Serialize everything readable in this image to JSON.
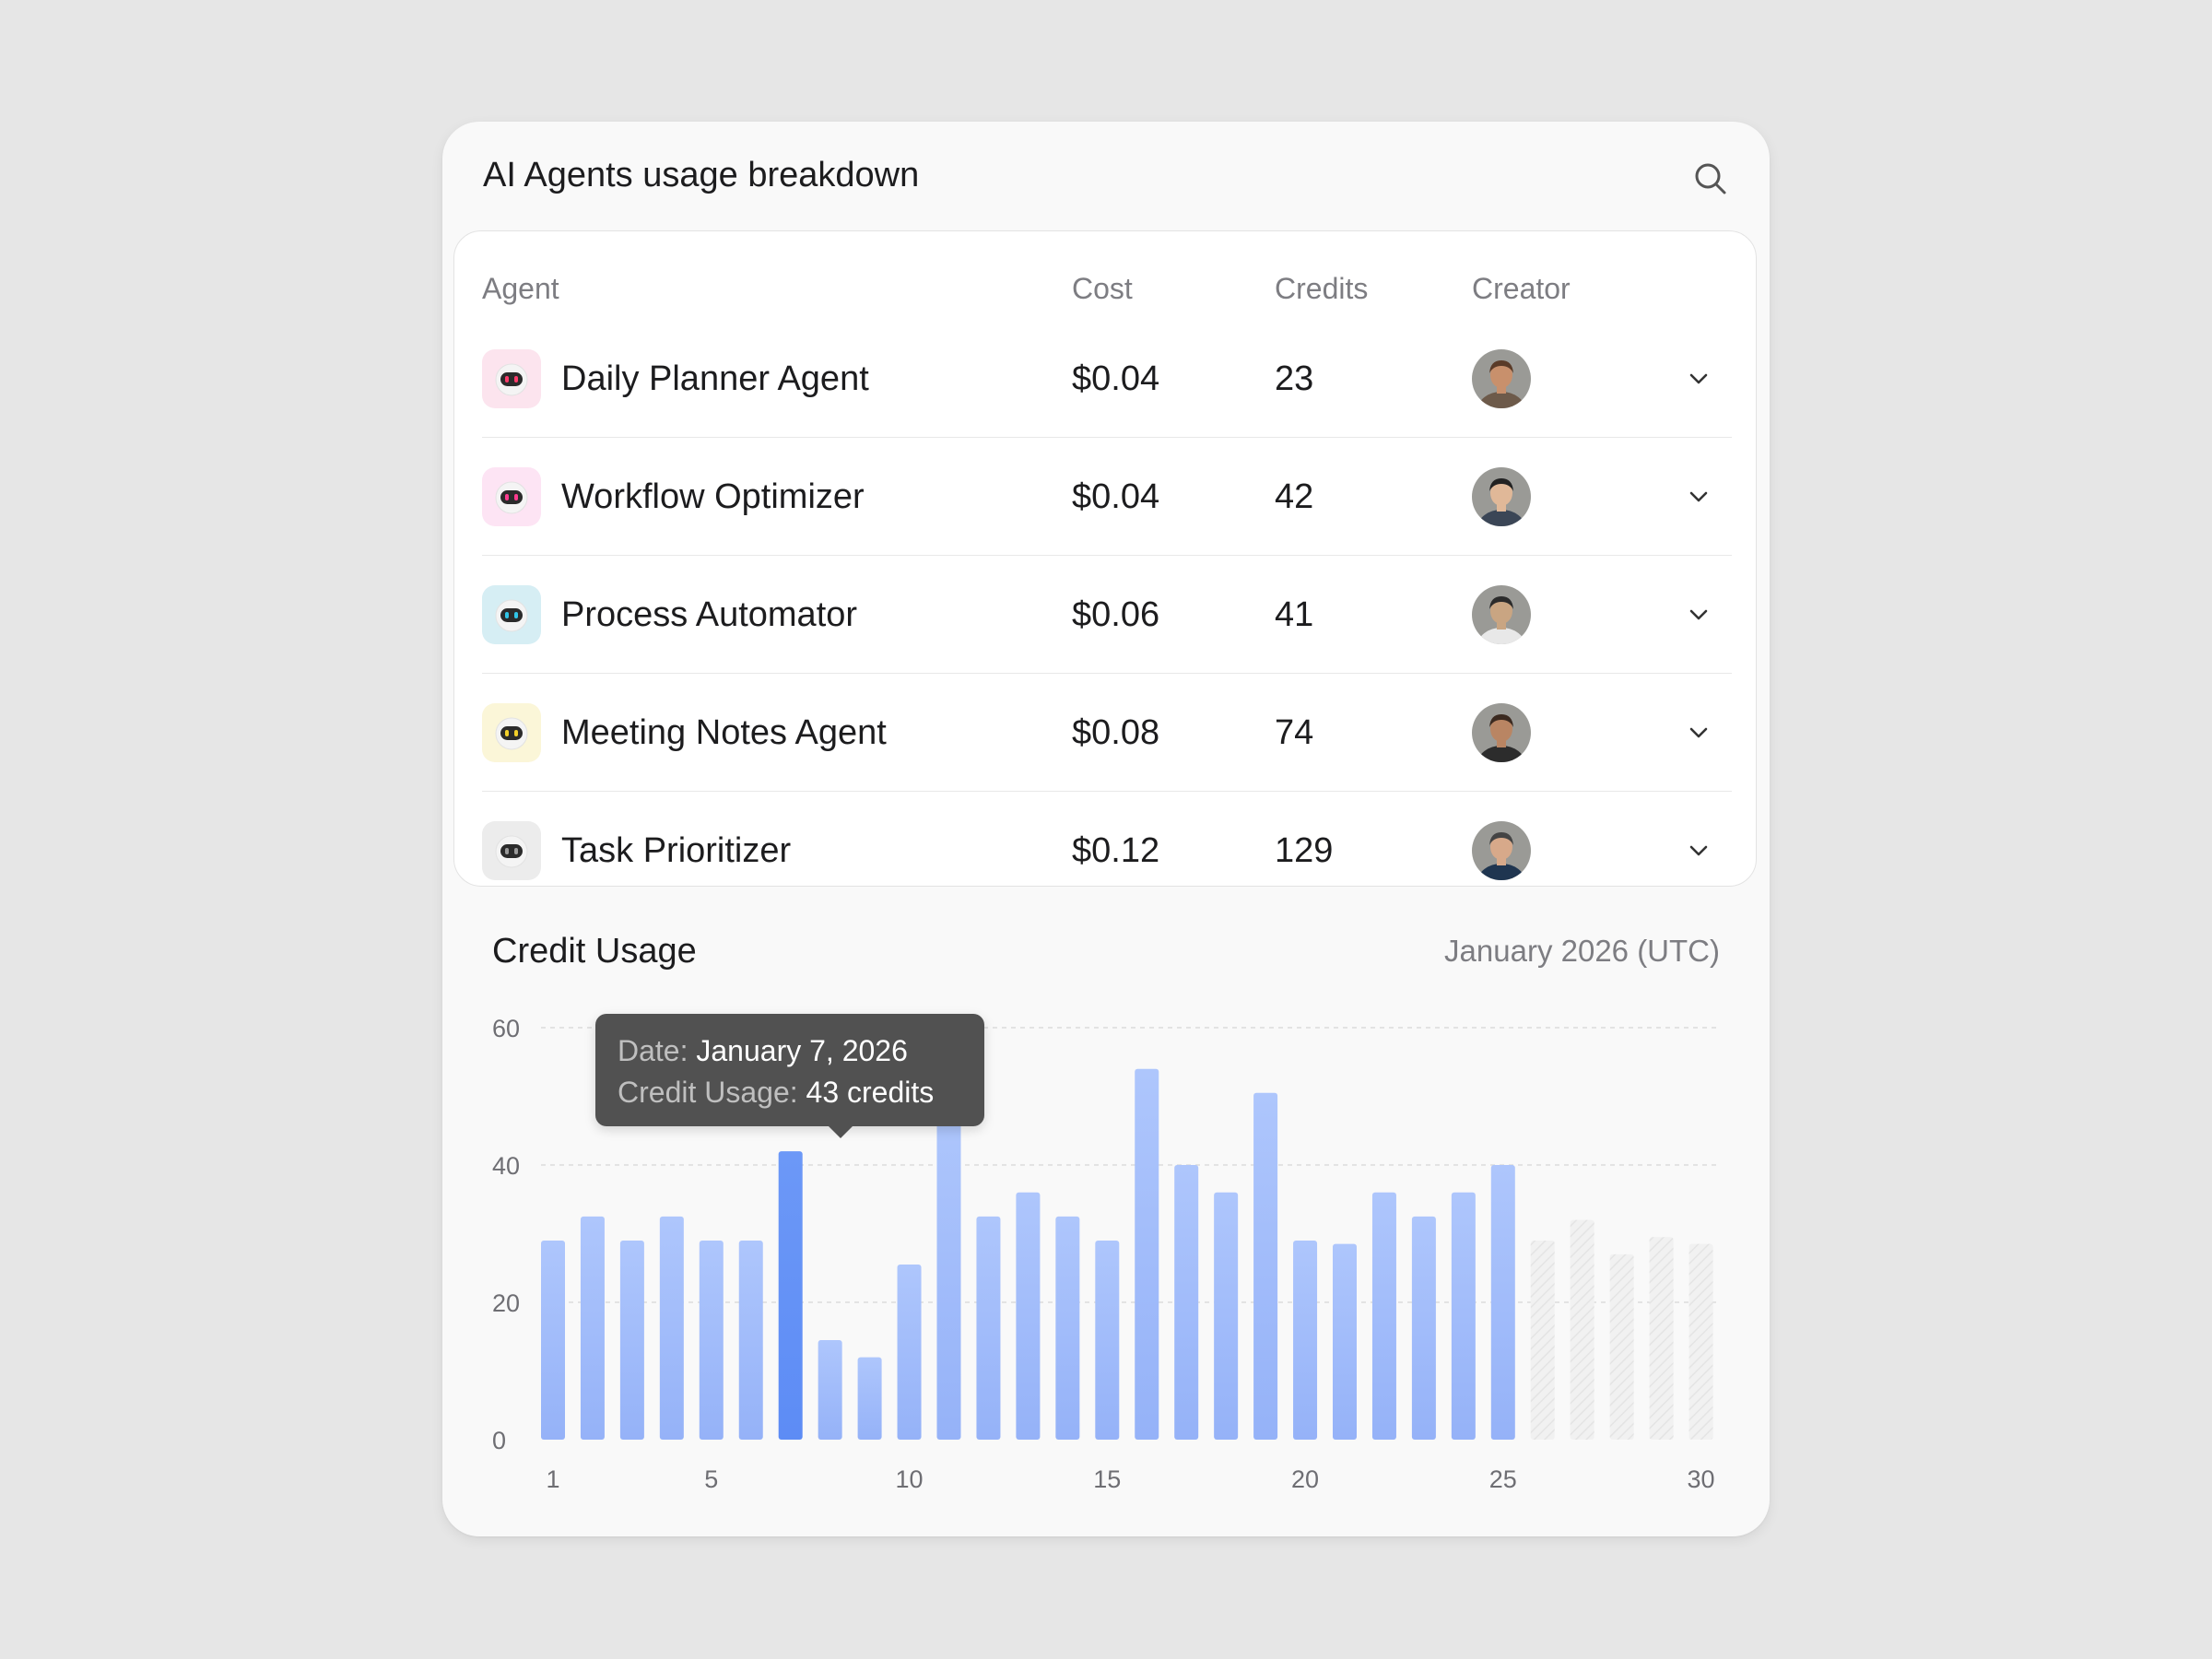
{
  "card": {
    "title": "AI Agents usage breakdown",
    "search_icon": "search-icon"
  },
  "table": {
    "headers": [
      "Agent",
      "Cost",
      "Credits",
      "Creator"
    ],
    "rows": [
      {
        "agent": "Daily Planner Agent",
        "cost": "$0.04",
        "credits": "23",
        "icon": "robot-icon",
        "icon_bg": "#fce4ee",
        "eye": "#ff3b6b",
        "avatar": "creator-avatar"
      },
      {
        "agent": "Workflow Optimizer",
        "cost": "$0.04",
        "credits": "42",
        "icon": "robot-icon",
        "icon_bg": "#fde4f4",
        "eye": "#ff3b8f",
        "avatar": "creator-avatar"
      },
      {
        "agent": "Process Automator",
        "cost": "$0.06",
        "credits": "41",
        "icon": "robot-icon",
        "icon_bg": "#d6eef4",
        "eye": "#31c4e6",
        "avatar": "creator-avatar"
      },
      {
        "agent": "Meeting Notes Agent",
        "cost": "$0.08",
        "credits": "74",
        "icon": "robot-icon",
        "icon_bg": "#fbf6d8",
        "eye": "#f2d02a",
        "avatar": "creator-avatar"
      },
      {
        "agent": "Task Prioritizer",
        "cost": "$0.12",
        "credits": "129",
        "icon": "robot-icon",
        "icon_bg": "#ececec",
        "eye": "#9a9a9a",
        "avatar": "creator-avatar"
      }
    ],
    "expand_icon": "chevron-down-icon"
  },
  "chart": {
    "title": "Credit Usage",
    "period": "January 2026 (UTC)"
  },
  "tooltip": {
    "date_label": "Date:",
    "date_value": "January 7, 2026",
    "usage_label": "Credit Usage:",
    "usage_value": "43 credits"
  },
  "chart_data": {
    "type": "bar",
    "x": [
      1,
      2,
      3,
      4,
      5,
      6,
      7,
      8,
      9,
      10,
      11,
      12,
      13,
      14,
      15,
      16,
      17,
      18,
      19,
      20,
      21,
      22,
      23,
      24,
      25,
      26,
      27,
      28,
      29,
      30
    ],
    "values": [
      29,
      32.5,
      29,
      32.5,
      29,
      29,
      42,
      14.5,
      12,
      25.5,
      48,
      32.5,
      36,
      32.5,
      29,
      54,
      40,
      36,
      50.5,
      29,
      28.5,
      36,
      32.5,
      36,
      40,
      29,
      32,
      27,
      29.5,
      28.5
    ],
    "highlighted_day": 7,
    "forecast_from_day": 26,
    "xticks": [
      1,
      5,
      10,
      15,
      20,
      25,
      30
    ],
    "yticks": [
      0,
      20,
      40,
      60
    ],
    "ylim": [
      0,
      60
    ],
    "grid": true,
    "colors": {
      "bar": "#a6c0fb",
      "highlight": "#6f9bf8",
      "forecast": "#eeeeee",
      "grid": "#dcdcdc"
    }
  }
}
